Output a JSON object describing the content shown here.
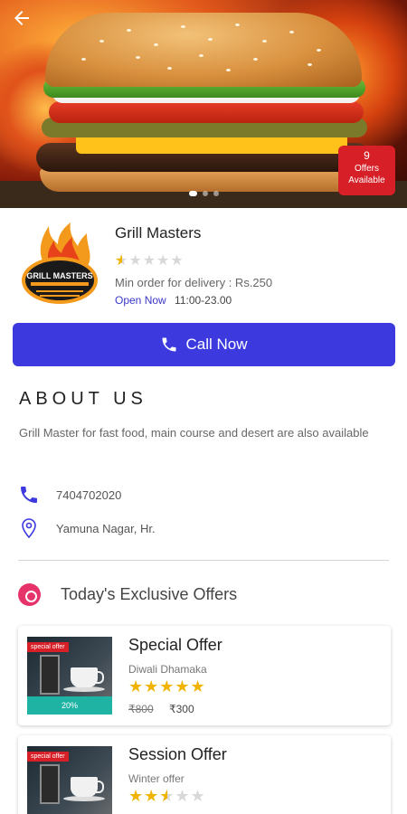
{
  "hero": {
    "offers_count": "9",
    "offers_label": "Offers Available"
  },
  "restaurant": {
    "name": "Grill Masters",
    "rating": 1,
    "rating_max": 5,
    "min_order": "Min order for delivery : Rs.250",
    "open_status": "Open Now",
    "hours": "11:00-23.00",
    "logo_text": "GRILL MASTERS"
  },
  "call_button": {
    "label": "Call Now"
  },
  "about": {
    "title": "ABOUT US",
    "text": "Grill Master for fast food, main course and desert are also available"
  },
  "contact": {
    "phone": "7404702020",
    "address": "Yamuna Nagar, Hr."
  },
  "offers_section": {
    "title": "Today's Exclusive Offers",
    "offers": [
      {
        "title": "Special Offer",
        "subtitle": "Diwali Dhamaka",
        "rating": 5,
        "ribbon": "special offer",
        "discount": "20%",
        "old_price": "₹800",
        "new_price": "₹300"
      },
      {
        "title": "Session Offer",
        "subtitle": "Winter offer",
        "rating": 2.5,
        "ribbon": "special offer"
      }
    ]
  },
  "colors": {
    "primary": "#3c3adf",
    "accent_red": "#d61f26",
    "star": "#f0b400",
    "teal": "#1fb3a4",
    "clock": "#e6336a"
  },
  "icons": {
    "back": "arrow-left-icon",
    "phone": "phone-icon",
    "location": "location-pin-icon",
    "clock": "clock-icon"
  }
}
